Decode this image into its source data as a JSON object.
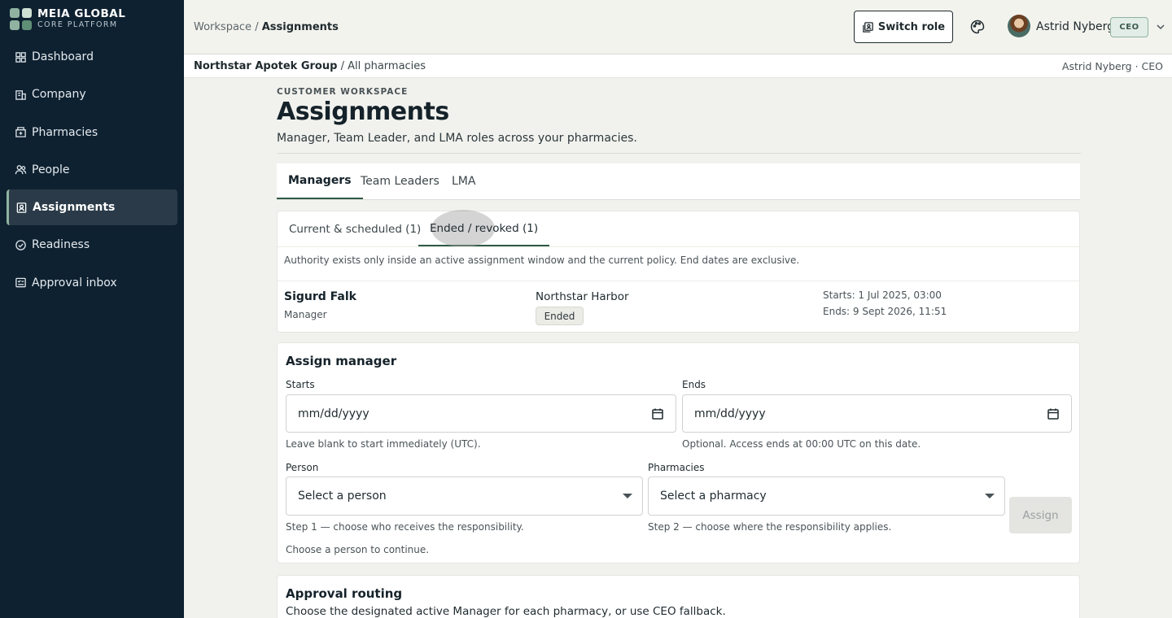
{
  "brand": {
    "name": "MEIA GLOBAL",
    "tagline": "CORE PLATFORM",
    "logo_colors": [
      "#8fb3a0",
      "#cfe0d5",
      "#8fb3a0",
      "#5f8f77"
    ]
  },
  "sidebar": {
    "items": [
      {
        "label": "Dashboard",
        "icon": "grid-icon",
        "active": false
      },
      {
        "label": "Company",
        "icon": "building-icon",
        "active": false
      },
      {
        "label": "Pharmacies",
        "icon": "pharmacy-icon",
        "active": false
      },
      {
        "label": "People",
        "icon": "people-icon",
        "active": false
      },
      {
        "label": "Assignments",
        "icon": "badge-icon",
        "active": true
      },
      {
        "label": "Readiness",
        "icon": "check-circle-icon",
        "active": false
      },
      {
        "label": "Approval inbox",
        "icon": "inbox-icon",
        "active": false
      }
    ]
  },
  "topbar": {
    "breadcrumb_root": "Workspace",
    "breadcrumb_sep": " / ",
    "breadcrumb_current": "Assignments",
    "switch_role_label": "Switch role",
    "user_name": "Astrid Nyberg",
    "user_role": "CEO"
  },
  "context": {
    "org": "Northstar Apotek Group",
    "scope": " / All pharmacies",
    "user_summary": "Astrid Nyberg · CEO"
  },
  "page": {
    "eyebrow": "CUSTOMER WORKSPACE",
    "title": "Assignments",
    "subtitle": "Manager, Team Leader, and LMA roles across your pharmacies."
  },
  "tabs": [
    {
      "label": "Managers",
      "active": true
    },
    {
      "label": "Team Leaders",
      "active": false
    },
    {
      "label": "LMA",
      "active": false
    }
  ],
  "subtabs": [
    {
      "label": "Current & scheduled (1)",
      "active": false
    },
    {
      "label": "Ended / revoked (1)",
      "active": true
    }
  ],
  "notice": "Authority exists only inside an active assignment window and the current policy. End dates are exclusive.",
  "assignments": [
    {
      "name": "Sigurd Falk",
      "role": "Manager",
      "pharmacy": "Northstar Harbor",
      "status": "Ended",
      "starts": "Starts: 1 Jul 2025, 03:00",
      "ends": "Ends: 9 Sept 2026, 11:51"
    }
  ],
  "assign_form": {
    "title": "Assign manager",
    "starts_label": "Starts",
    "starts_placeholder": "mm/dd/yyyy",
    "starts_hint": "Leave blank to start immediately (UTC).",
    "ends_label": "Ends",
    "ends_placeholder": "mm/dd/yyyy",
    "ends_hint": "Optional. Access ends at 00:00 UTC on this date.",
    "person_label": "Person",
    "person_value": "Select a person",
    "person_hint": "Step 1 — choose who receives the responsibility.",
    "pharmacies_label": "Pharmacies",
    "pharmacies_value": "Select a pharmacy",
    "pharmacies_hint": "Step 2 — choose where the responsibility applies.",
    "status_hint": "Choose a person to continue.",
    "assign_label": "Assign"
  },
  "approval_routing": {
    "title": "Approval routing",
    "description": "Choose the designated active Manager for each pharmacy, or use CEO fallback."
  }
}
